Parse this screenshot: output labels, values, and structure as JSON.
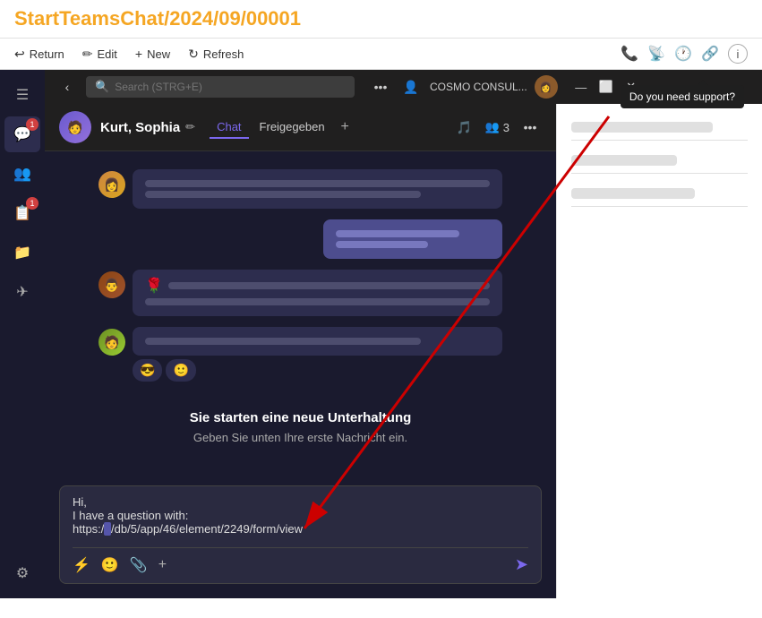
{
  "title": "StartTeamsChat/2024/09/00001",
  "title_color": "#f5a623",
  "toolbar": {
    "return_label": "Return",
    "edit_label": "Edit",
    "new_label": "New",
    "refresh_label": "Refresh"
  },
  "support_tooltip": "Do you need support?",
  "teams": {
    "search_placeholder": "Search (STRG+E)",
    "cosmo_label": "COSMO CONSUL...",
    "chat_user": "Kurt, Sophia",
    "chat_tab": "Chat",
    "freigegeben_tab": "Freigegeben",
    "participants_count": "3",
    "new_conv_title": "Sie starten eine neue Unterhaltung",
    "new_conv_sub": "Geben Sie unten Ihre erste Nachricht ein.",
    "message_text_line1": "Hi,",
    "message_text_line2": "I have a question with:",
    "message_text_line3": "https:/",
    "message_text_line3_highlight": "                    ",
    "message_text_line3_end": "/db/5/app/46/element/2249/form/view"
  },
  "input_toolbar_icons": {
    "lightning": "⚡",
    "emoji": "🙂",
    "attachment": "📎",
    "plus": "+",
    "send": "➤"
  },
  "right_panel": {
    "fields": [
      {
        "label": "",
        "value": ""
      },
      {
        "label": "",
        "value": ""
      },
      {
        "label": "",
        "value": ""
      }
    ]
  },
  "nav_items": [
    {
      "icon": "☰",
      "label": "",
      "badge": ""
    },
    {
      "icon": "💬",
      "label": "",
      "badge": "1"
    },
    {
      "icon": "👥",
      "label": "",
      "badge": ""
    },
    {
      "icon": "📋",
      "label": "",
      "badge": "1"
    },
    {
      "icon": "📁",
      "label": "",
      "badge": ""
    },
    {
      "icon": "✈",
      "label": "",
      "badge": ""
    },
    {
      "icon": "⚙",
      "label": "",
      "badge": ""
    }
  ]
}
